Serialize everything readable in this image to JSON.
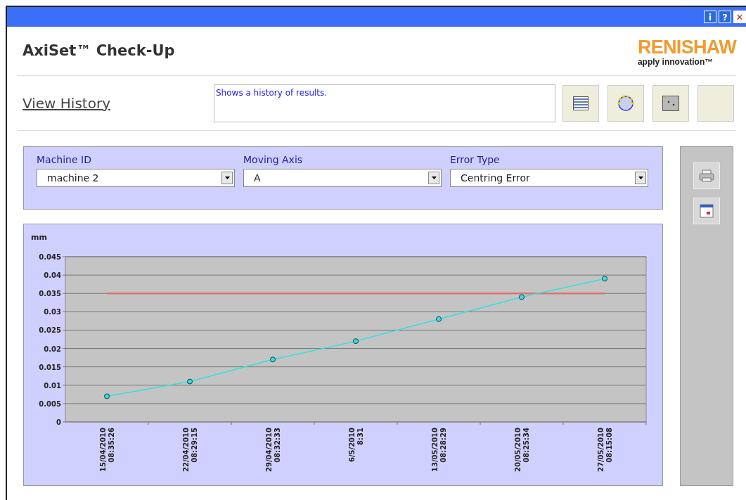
{
  "title_bar": {
    "buttons": [
      {
        "kind": "info",
        "label": "i"
      },
      {
        "kind": "help",
        "label": "?"
      },
      {
        "kind": "close",
        "label": "✕"
      }
    ]
  },
  "header": {
    "title": "AxiSet™ Check-Up",
    "logo": {
      "name": "RENISHAW",
      "tagline": "apply innovation™"
    }
  },
  "view": {
    "title": "View History",
    "description": "Shows a history of results.",
    "tools": [
      {
        "kind": "table"
      },
      {
        "kind": "circle"
      },
      {
        "kind": "scatter"
      },
      {
        "kind": "blank"
      }
    ]
  },
  "filters": [
    {
      "label": "Machine ID",
      "value": "machine 2"
    },
    {
      "label": "Moving Axis",
      "value": "A"
    },
    {
      "label": "Error Type",
      "value": "Centring Error"
    }
  ],
  "chart": {
    "chart_data": {
      "type": "line",
      "ylabel": "mm",
      "categories": [
        "15/04/2010\n08:35:26",
        "22/04/2010\n08:29:15",
        "29/04/2010\n08:32:33",
        "6/5/2010\n8:31",
        "13/05/2010\n08:28:29",
        "20/05/2010\n08:25:34",
        "27/05/2010\n08:15:08"
      ],
      "ylim": [
        0,
        0.045
      ],
      "grid": true,
      "yticks": [
        0,
        0.005,
        0.01,
        0.015,
        0.02,
        0.025,
        0.03,
        0.035,
        0.04,
        0.045
      ],
      "series": [
        {
          "color": "#33e0e0",
          "marker": true,
          "values": [
            0.007,
            0.011,
            0.017,
            0.022,
            0.028,
            0.034,
            0.039
          ]
        },
        {
          "color": "#e07070",
          "marker": false,
          "values": [
            0.035,
            0.035,
            0.035,
            0.035,
            0.035,
            0.035,
            0.035
          ]
        }
      ]
    }
  },
  "side_tools": [
    {
      "kind": "print"
    },
    {
      "kind": "calendar"
    }
  ]
}
